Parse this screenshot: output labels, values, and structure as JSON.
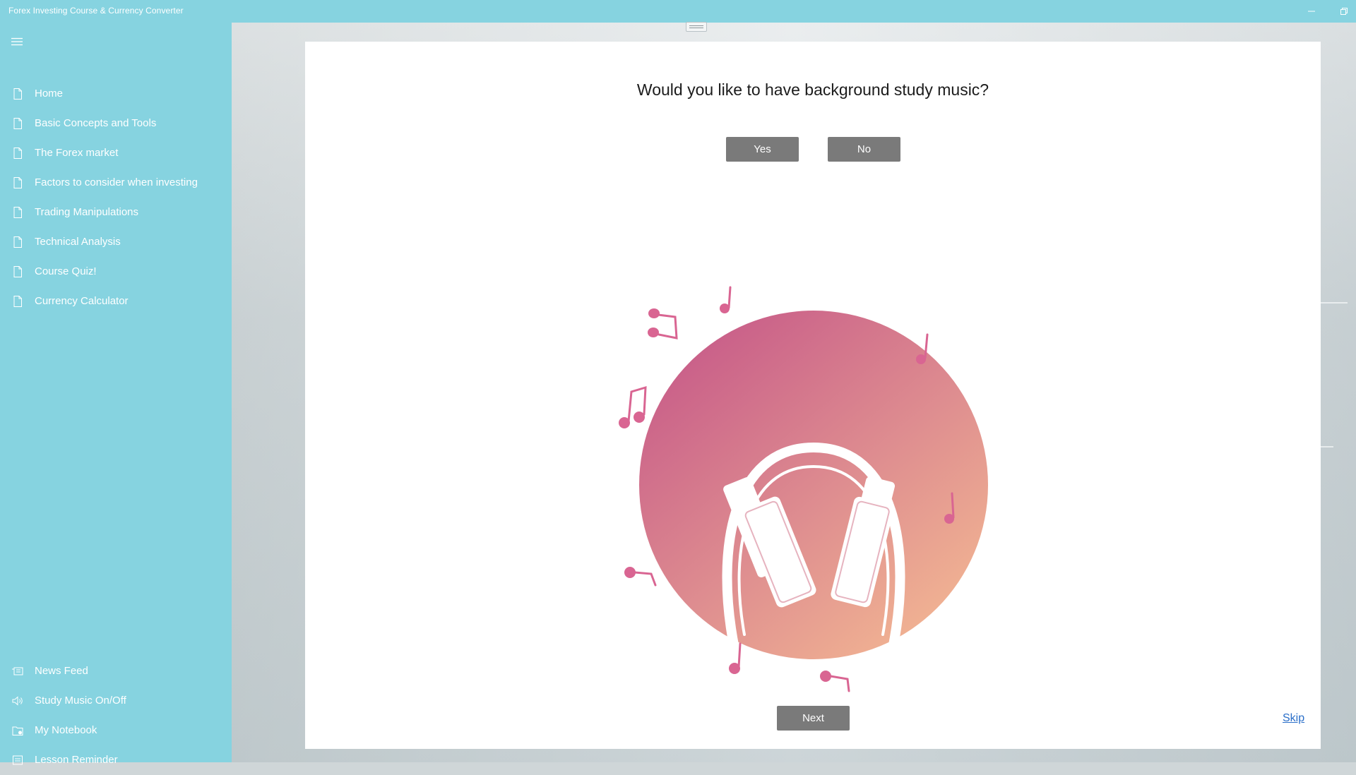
{
  "app": {
    "title": "Forex Investing Course & Currency Converter"
  },
  "sidebar": {
    "items": [
      {
        "label": "Home",
        "icon": "document-icon"
      },
      {
        "label": "Basic Concepts and Tools",
        "icon": "document-icon"
      },
      {
        "label": "The Forex market",
        "icon": "document-icon"
      },
      {
        "label": "Factors to consider when investing",
        "icon": "document-icon"
      },
      {
        "label": "Trading Manipulations",
        "icon": "document-icon"
      },
      {
        "label": "Technical Analysis",
        "icon": "document-icon"
      },
      {
        "label": "Course Quiz!",
        "icon": "document-icon"
      },
      {
        "label": "Currency Calculator",
        "icon": "document-icon"
      }
    ],
    "bottom_items": [
      {
        "label": "News Feed",
        "icon": "news-icon"
      },
      {
        "label": "Study Music On/Off",
        "icon": "speaker-icon"
      },
      {
        "label": "My Notebook",
        "icon": "notebook-icon"
      },
      {
        "label": "Lesson Reminder",
        "icon": "reminder-icon"
      }
    ]
  },
  "dialog": {
    "question": "Would you like to have background study music?",
    "yes_label": "Yes",
    "no_label": "No",
    "next_label": "Next",
    "skip_label": "Skip"
  },
  "colors": {
    "sidebar_bg": "#86d3e0",
    "button_bg": "#7a7a7a",
    "link": "#2b6fc9",
    "circle_top": "#cc6a8e",
    "circle_bottom": "#f0b290",
    "note": "#d96592"
  }
}
